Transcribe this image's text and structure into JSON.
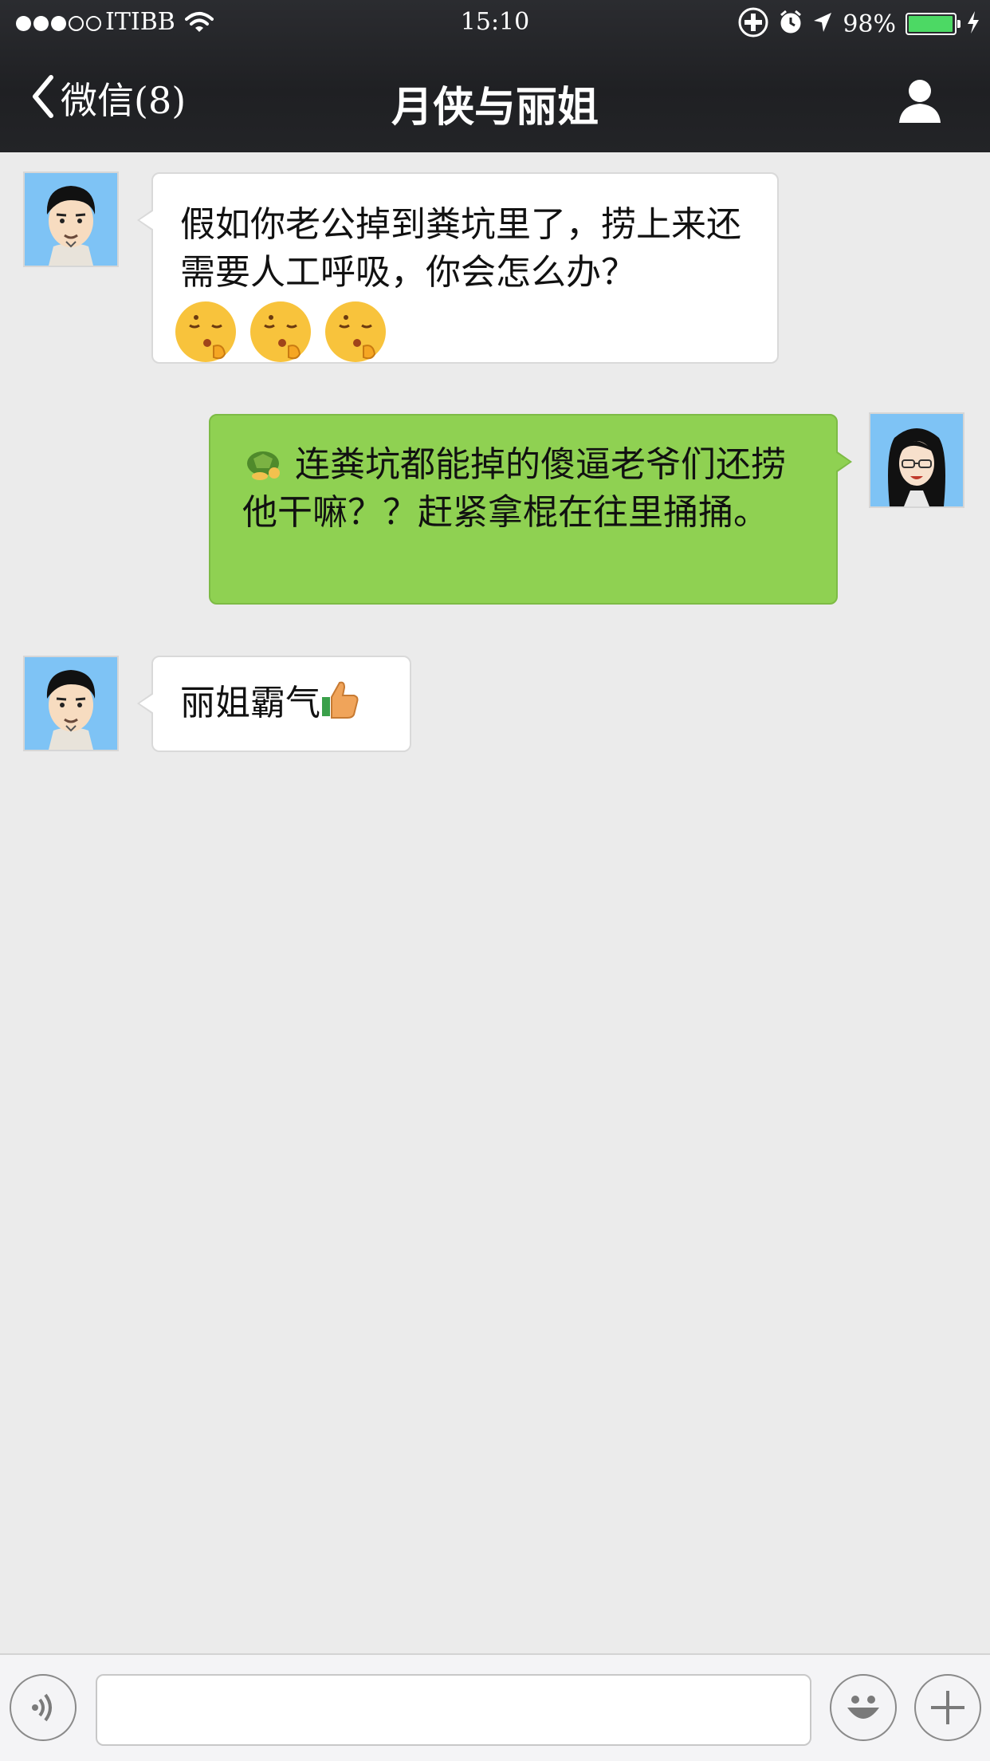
{
  "status_bar": {
    "carrier": "ITIBB",
    "signal_bars_filled": 3,
    "signal_bars_total": 5,
    "time": "15:10",
    "battery_percent": "98%",
    "battery_level": 0.98,
    "battery_color": "#4cd964",
    "icons": [
      "wifi-icon",
      "screen-lock-icon",
      "alarm-icon",
      "location-icon",
      "battery-icon",
      "charging-icon"
    ]
  },
  "nav_bar": {
    "back_label": "微信(8)",
    "title": "月侠与丽姐",
    "right_icon": "profile-icon"
  },
  "messages": [
    {
      "direction": "incoming",
      "sender_avatar": "male-cartoon-avatar",
      "text": "假如你老公掉到粪坑里了，捞上来还需要人工呼吸，你会怎么办？",
      "emojis": [
        "shushing-face",
        "shushing-face",
        "shushing-face"
      ]
    },
    {
      "direction": "outgoing",
      "sender_avatar": "female-cartoon-avatar",
      "leading_emoji": "turtle",
      "text": "连粪坑都能掉的傻逼老爷们还捞他干嘛？？赶紧拿棍在往里捅捅。"
    },
    {
      "direction": "incoming",
      "sender_avatar": "male-cartoon-avatar",
      "text": "丽姐霸气",
      "trailing_emoji": "thumbs-up"
    }
  ],
  "input_bar": {
    "left_icon": "voice-icon",
    "input_value": "",
    "right_icons": [
      "emoji-icon",
      "plus-icon"
    ]
  },
  "colors": {
    "nav_background": "#232427",
    "chat_background": "#ebebeb",
    "outgoing_bubble": "#8fd152",
    "incoming_bubble": "#ffffff"
  }
}
